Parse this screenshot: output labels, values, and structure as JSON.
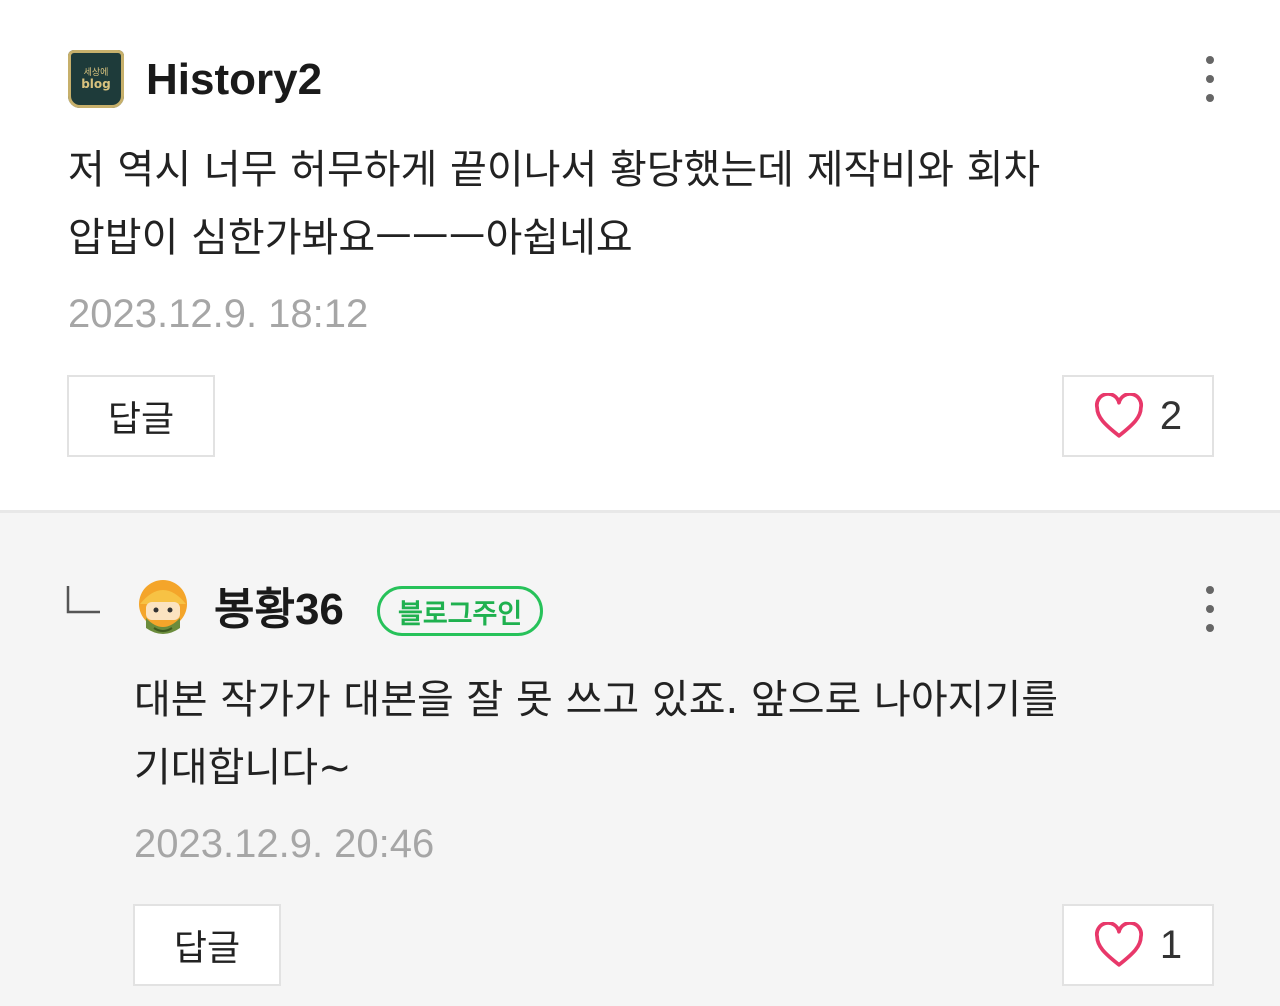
{
  "comments": [
    {
      "author": "History2",
      "avatar_text_top": "세상에",
      "avatar_text_bottom": "blog",
      "lines": [
        "저 역시 너무 허무하게 끝이나서 황당했는데 제작비와 회차",
        "압밥이 심한가봐요ㅡㅡㅡ아쉽네요"
      ],
      "date": "2023.12.9. 18:12",
      "reply_label": "답글",
      "like_count": "2"
    },
    {
      "author": "봉황36",
      "badge": "블로그주인",
      "lines": [
        "대본 작가가 대본을 잘 못 쓰고 있죠. 앞으로 나아지기를",
        "기대합니다~"
      ],
      "date": "2023.12.9. 20:46",
      "reply_label": "답글",
      "like_count": "1"
    }
  ],
  "icons": {
    "more": "more-vertical-icon",
    "like": "heart-outline-icon",
    "reply_indicator": "reply-corner-icon"
  },
  "colors": {
    "heart": "#e8386a",
    "badge": "#27c25a",
    "date": "#a6a6a6",
    "reply_background": "#f5f5f5"
  }
}
